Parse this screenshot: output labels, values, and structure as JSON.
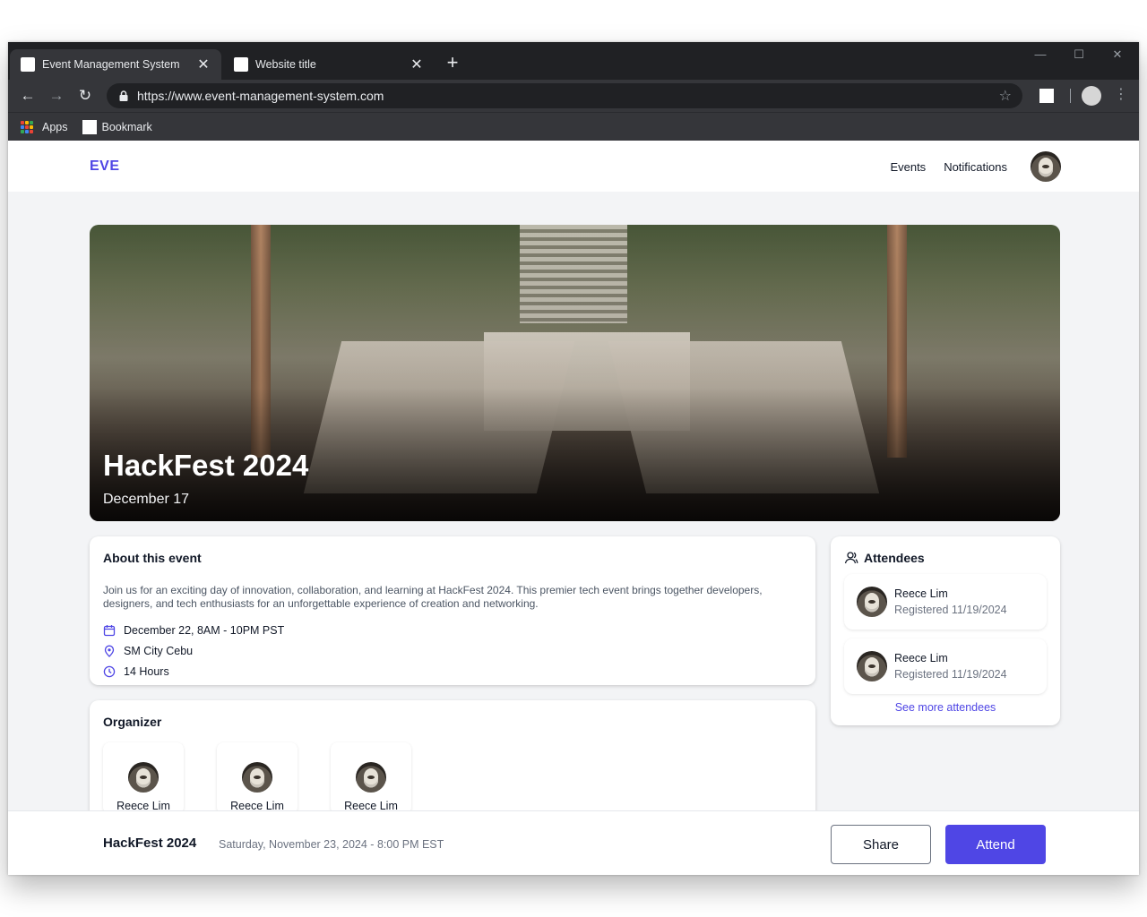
{
  "browser": {
    "tabs": [
      {
        "title": "Event Management System",
        "close": "✕"
      },
      {
        "title": "Website title",
        "close": "✕"
      }
    ],
    "new_tab": "+",
    "url": "https://www.event-management-system.com",
    "bookmarks": {
      "apps_label": "Apps",
      "bookmark_label": "Bookmark"
    }
  },
  "app": {
    "logo": "EVE",
    "nav": {
      "events": "Events",
      "notifications": "Notifications"
    }
  },
  "hero": {
    "title": "HackFest 2024",
    "date": "December 17"
  },
  "about": {
    "heading": "About this event",
    "description": "Join us for an exciting day of innovation, collaboration, and learning at HackFest 2024. This premier tech event brings together developers, designers, and tech enthusiasts for an unforgettable experience of creation and networking.",
    "datetime": "December 22, 8AM - 10PM PST",
    "location": "SM City Cebu",
    "duration": "14 Hours"
  },
  "organizer": {
    "heading": "Organizer",
    "people": [
      {
        "name": "Reece Lim"
      },
      {
        "name": "Reece Lim"
      },
      {
        "name": "Reece Lim"
      }
    ]
  },
  "attendees": {
    "heading": "Attendees",
    "list": [
      {
        "name": "Reece Lim",
        "registered": "Registered 11/19/2024"
      },
      {
        "name": "Reece Lim",
        "registered": "Registered 11/19/2024"
      }
    ],
    "see_more": "See more attendees"
  },
  "footer": {
    "title": "HackFest 2024",
    "datetime": "Saturday, November 23, 2024 - 8:00 PM EST",
    "share_label": "Share",
    "attend_label": "Attend"
  },
  "colors": {
    "accent": "#4f46e5",
    "chrome_dark": "#202124"
  },
  "icons": [
    "back-arrow-icon",
    "forward-arrow-icon",
    "reload-icon",
    "lock-icon",
    "star-icon",
    "calendar-icon",
    "location-pin-icon",
    "clock-icon",
    "attendees-icon"
  ]
}
